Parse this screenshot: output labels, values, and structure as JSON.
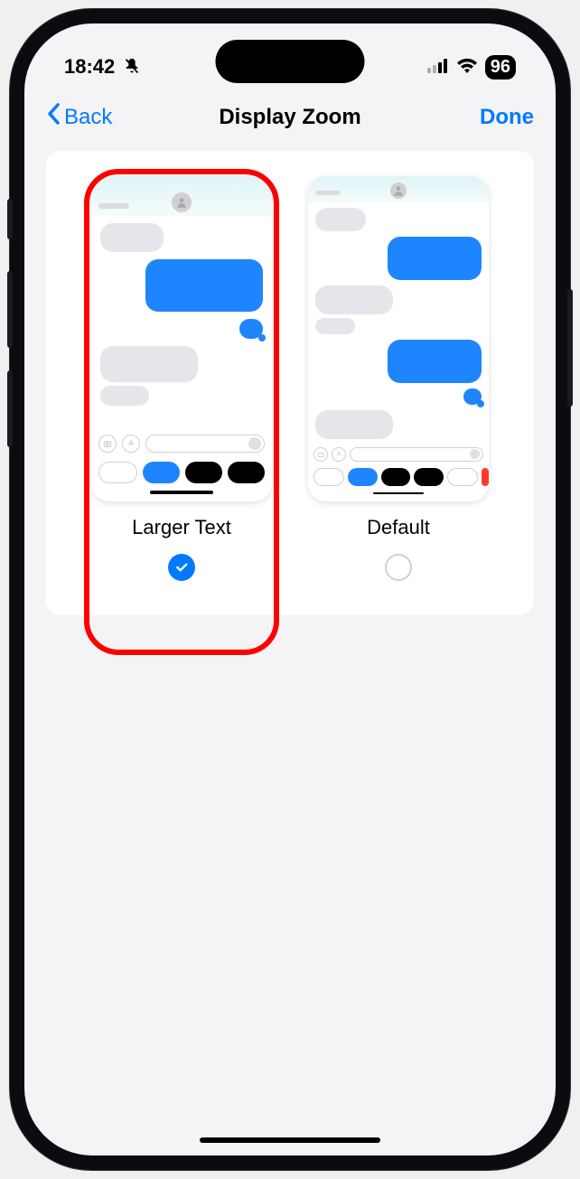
{
  "status": {
    "time": "18:42",
    "battery": "96"
  },
  "nav": {
    "back_label": "Back",
    "title": "Display Zoom",
    "done_label": "Done"
  },
  "options": {
    "larger": {
      "label": "Larger Text",
      "selected": true
    },
    "default": {
      "label": "Default",
      "selected": false
    }
  }
}
